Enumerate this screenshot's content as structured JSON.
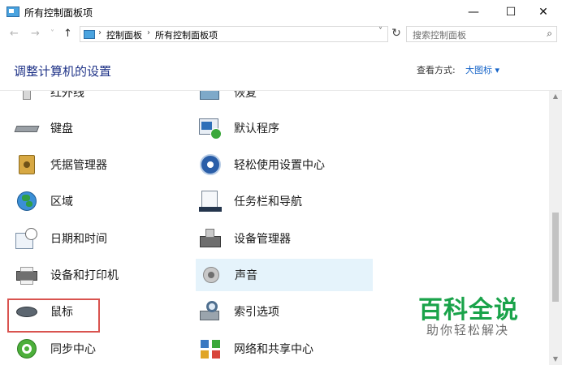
{
  "window": {
    "title": "所有控制面板项",
    "controls": {
      "minimize": "—",
      "maximize": "☐",
      "close": "✕"
    }
  },
  "address": {
    "back": "←",
    "forward": "→",
    "recent": "˅",
    "up": "↑",
    "breadcrumb": [
      "控制面板",
      "所有控制面板项"
    ],
    "separator": "›",
    "dropdown": "˅",
    "refresh": "↻",
    "search_placeholder": "搜索控制面板",
    "search_icon": "⌕"
  },
  "header": {
    "title": "调整计算机的设置",
    "view_by_label": "查看方式:",
    "view_by_value": "大图标 ▾"
  },
  "items": {
    "left": [
      {
        "label": "红外线",
        "icon": "infrared-icon"
      },
      {
        "label": "键盘",
        "icon": "keyboard-icon"
      },
      {
        "label": "凭据管理器",
        "icon": "credential-manager-icon"
      },
      {
        "label": "区域",
        "icon": "region-globe-icon"
      },
      {
        "label": "日期和时间",
        "icon": "date-time-icon"
      },
      {
        "label": "设备和打印机",
        "icon": "printer-icon"
      },
      {
        "label": "鼠标",
        "icon": "mouse-icon"
      },
      {
        "label": "同步中心",
        "icon": "sync-center-icon"
      }
    ],
    "right": [
      {
        "label": "恢复",
        "icon": "recovery-icon"
      },
      {
        "label": "默认程序",
        "icon": "default-programs-icon"
      },
      {
        "label": "轻松使用设置中心",
        "icon": "ease-of-access-icon"
      },
      {
        "label": "任务栏和导航",
        "icon": "taskbar-icon"
      },
      {
        "label": "设备管理器",
        "icon": "device-manager-icon"
      },
      {
        "label": "声音",
        "icon": "sound-icon"
      },
      {
        "label": "索引选项",
        "icon": "indexing-options-icon"
      },
      {
        "label": "网络和共享中心",
        "icon": "network-sharing-icon"
      }
    ]
  },
  "scrollbar": {
    "up": "▲",
    "down": "▼"
  },
  "watermark": {
    "title": "百科全说",
    "subtitle": "助你轻松解决"
  },
  "colors": {
    "title_blue": "#1e3287",
    "link_blue": "#1664c8",
    "selection_red": "#d9534f",
    "hover": "#e5f3fb",
    "watermark_green": "#1aa34a"
  }
}
